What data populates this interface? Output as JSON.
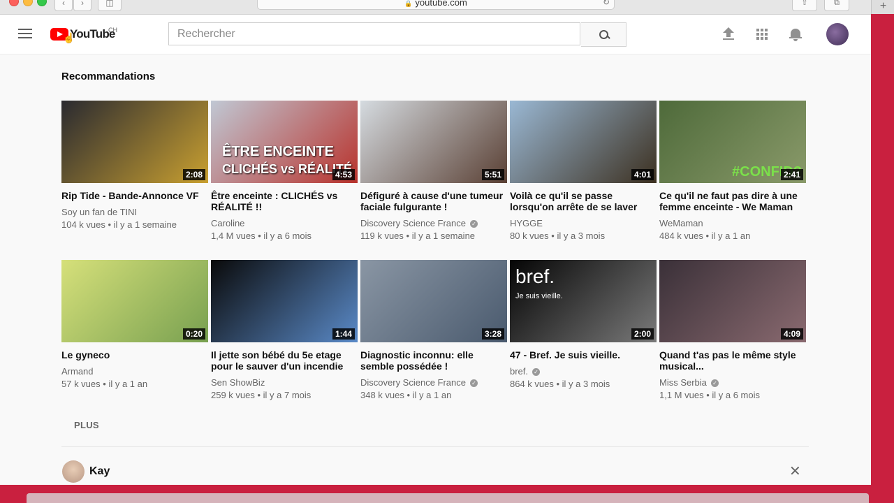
{
  "browser": {
    "url": "youtube.com"
  },
  "masthead": {
    "logo": "YouTube",
    "country": "CH",
    "search_placeholder": "Rechercher"
  },
  "section": {
    "title": "Recommandations",
    "more_label": "PLUS"
  },
  "videos": [
    {
      "title": "Rip Tide - Bande-Annonce VF",
      "channel": "Soy un fan de TINI",
      "verified": false,
      "views": "104 k vues",
      "age": "il y a 1 semaine",
      "duration": "2:08",
      "colors": [
        "#2a2a30",
        "#c9a030"
      ]
    },
    {
      "title": "Être enceinte : CLICHÉS vs RÉALITÉ !!",
      "channel": "Caroline",
      "verified": false,
      "views": "1,4 M vues",
      "age": "il y a 6 mois",
      "duration": "4:53",
      "overlay": "ÊTRE ENCEINTE",
      "overlay2": "CLICHÉS vs RÉALITÉ",
      "colors": [
        "#c0c8d4",
        "#b8322c"
      ]
    },
    {
      "title": "Défiguré à cause d'une tumeur faciale fulgurante !",
      "channel": "Discovery Science France",
      "verified": true,
      "views": "119 k vues",
      "age": "il y a 1 semaine",
      "duration": "5:51",
      "colors": [
        "#d5dbe0",
        "#5a4034"
      ]
    },
    {
      "title": "Voilà ce qu'il se passe lorsqu'on arrête de se laver",
      "channel": "HYGGE",
      "verified": false,
      "views": "80 k vues",
      "age": "il y a 3 mois",
      "duration": "4:01",
      "colors": [
        "#9ab8d4",
        "#3c3020"
      ]
    },
    {
      "title": "Ce qu'il ne faut pas dire à une femme enceinte - We Maman",
      "channel": "WeMaman",
      "verified": false,
      "views": "484 k vues",
      "age": "il y a 1 an",
      "duration": "2:41",
      "overlay": "#CONFID?",
      "colors": [
        "#4e6a3a",
        "#8a9a6a"
      ]
    },
    {
      "title": "Le gyneco",
      "channel": "Armand",
      "verified": false,
      "views": "57 k vues",
      "age": "il y a 1 an",
      "duration": "0:20",
      "colors": [
        "#d6e07a",
        "#78a050"
      ]
    },
    {
      "title": "Il jette son bébé du 5e etage pour le sauver d'un incendie",
      "channel": "Sen ShowBiz",
      "verified": false,
      "views": "259 k vues",
      "age": "il y a 7 mois",
      "duration": "1:44",
      "colors": [
        "#0a0a0a",
        "#5a8ac8"
      ]
    },
    {
      "title": "Diagnostic inconnu: elle semble possédée !",
      "channel": "Discovery Science France",
      "verified": true,
      "views": "348 k vues",
      "age": "il y a 1 an",
      "duration": "3:28",
      "colors": [
        "#8a96a4",
        "#4a5a6e"
      ]
    },
    {
      "title": "47 - Bref. Je suis vieille.",
      "channel": "bref.",
      "verified": true,
      "views": "864 k vues",
      "age": "il y a 3 mois",
      "duration": "2:00",
      "overlay": "bref.",
      "overlay2": "Je suis vieille.",
      "colors": [
        "#050505",
        "#7a7a7a"
      ]
    },
    {
      "title": "Quand t'as pas le même style musical...",
      "channel": "Miss Serbia",
      "verified": true,
      "views": "1,1 M vues",
      "age": "il y a 6 mois",
      "duration": "4:09",
      "colors": [
        "#3a3038",
        "#8a6a70"
      ]
    }
  ],
  "next_section": {
    "name": "Kay"
  }
}
